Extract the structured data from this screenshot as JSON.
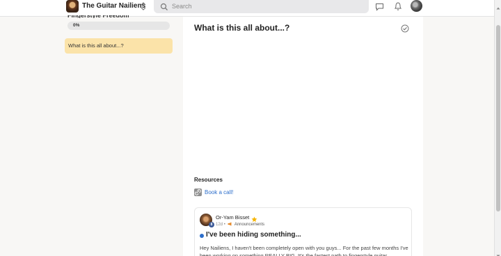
{
  "header": {
    "group_name": "The Guitar Nailiens",
    "search_placeholder": "Search"
  },
  "sidebar": {
    "course_title": "Fingerstyle Freedom",
    "progress_label": "0%",
    "progress_value": 0,
    "lessons": [
      {
        "label": "What is this all about...?",
        "active": true
      }
    ]
  },
  "lesson": {
    "title": "What is this all about...?",
    "completed": false
  },
  "resources": {
    "heading": "Resources",
    "items": [
      {
        "label": "Book a call!",
        "icon": "link-icon"
      }
    ]
  },
  "post": {
    "author": "Or-Yam Bisset",
    "level": "8",
    "time": "12d",
    "separator": "•",
    "category": "Announcements",
    "title": "I've been hiding something...",
    "excerpt": "Hey Nailiens, I haven't been completely open with you guys... For the past few months I've been working on something REALLY BIG. It's the fastest path to fingerstyle guitar..."
  },
  "colors": {
    "accent": "#2c6ecb",
    "active_lesson_bg": "#fbe3a9",
    "star": "#f5b400"
  }
}
